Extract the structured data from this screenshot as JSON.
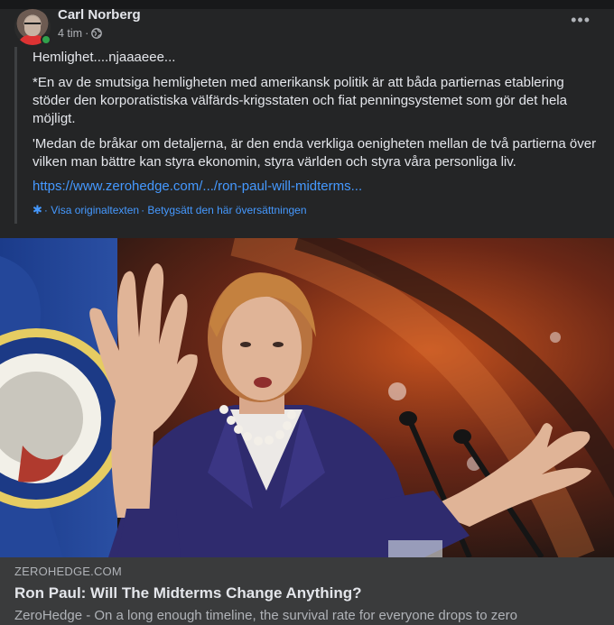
{
  "post": {
    "author": "Carl Norberg",
    "time": "4 tim",
    "separator": "·",
    "more_label": "•••",
    "quote": {
      "line1": "Hemlighet....njaaaeee...",
      "line2": "*En av de smutsiga hemligheten med amerikansk politik är att båda partiernas etablering stöder den korporatistiska välfärds-krigsstaten och fiat penningsystemet som gör det hela möjligt.",
      "line3": "'Medan de bråkar om detaljerna, är den enda verkliga oenigheten mellan de två partierna över vilken man bättre kan styra ekonomin, styra världen och styra våra personliga liv.",
      "link": "https://www.zerohedge.com/.../ron-paul-will-midterms..."
    },
    "translation": {
      "see_original": "· Visa originaltexten",
      "rate": "· Betygsätt den här översättningen"
    }
  },
  "link_preview": {
    "domain": "ZEROHEDGE.COM",
    "title": "Ron Paul: Will The Midterms Change Anything?",
    "description": "ZeroHedge - On a long enough timeline, the survival rate for everyone drops to zero"
  },
  "colors": {
    "background": "#242526",
    "link": "#4599ff",
    "online": "#31a24c"
  }
}
